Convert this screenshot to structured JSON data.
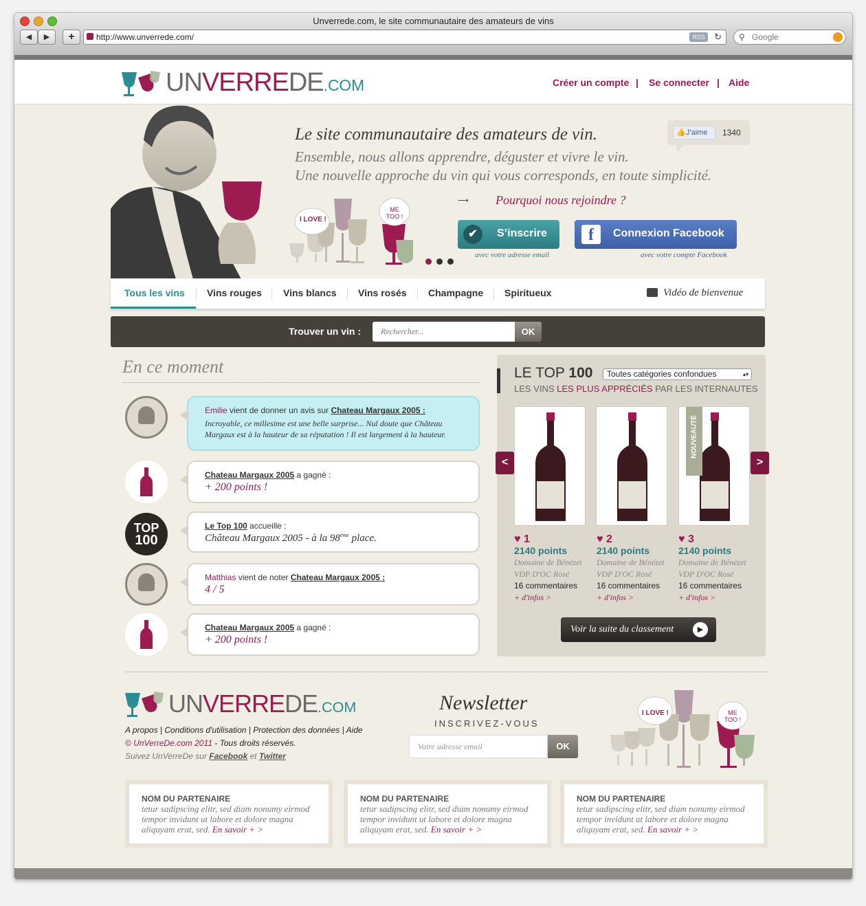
{
  "browser": {
    "window_title": "Unverrede.com, le site communautaire des amateurs de vins",
    "url": "http://www.unverrede.com/",
    "search_placeholder": "Google",
    "rss": "RSS"
  },
  "logo": {
    "part1": "UN",
    "part2": "VERRE",
    "part3": "DE",
    "part4": ".COM"
  },
  "header": {
    "links": [
      "Créer un compte",
      "Se connecter",
      "Aide"
    ],
    "separator": "|"
  },
  "hero": {
    "title": "Le site communautaire des amateurs de vin.",
    "line2": "Ensemble, nous allons apprendre, déguster et vivre le vin.",
    "line3": "Une nouvelle approche du vin qui vous corresponds, en toute simplicité.",
    "why_join": "Pourquoi nous rejoindre ?",
    "bubble_love": "I LOVE !",
    "bubble_metoo": "ME TOO !",
    "like_label": "J'aime",
    "like_count": "1340",
    "signup_label": "S’inscrire",
    "signup_sub": "avec votre adresse email",
    "facebook_label": "Connexion Facebook",
    "facebook_sub": "avec votre compte Facebook",
    "facebook_f": "f"
  },
  "menu": {
    "items": [
      "Tous les vins",
      "Vins rouges",
      "Vins blancs",
      "Vins rosés",
      "Champagne",
      "Spiritueux"
    ],
    "video": "Vidéo de bienvenue"
  },
  "find": {
    "label": "Trouver un vin :",
    "placeholder": "Rechercher...",
    "ok": "OK"
  },
  "feed": {
    "title": "En ce moment",
    "items": [
      {
        "user": "Emilie",
        "text": " vient de donner un avis sur ",
        "wine": "Chateau Margaux 2005 :",
        "quote": "Incroyable, ce millesime est une belle surprise... Nul doute que Château Margaux est à la hauteur de sa réputation ! Il est largement à la hauteur."
      },
      {
        "wine": "Chateau Margaux 2005",
        "text": " a gagné :",
        "points": "+ 200 points !"
      },
      {
        "wine": "Le Top 100",
        "text": " accueille :",
        "detail": "Château Margaux 2005 - à la 98",
        "sup": "ème",
        "detail_end": " place."
      },
      {
        "user": "Matthias",
        "text": " vient de noter ",
        "wine": "Chateau Margaux 2005 :",
        "rating": "4 / 5"
      },
      {
        "wine": "Chateau Margaux 2005",
        "text": " a gagné :",
        "points": "+ 200 points !"
      }
    ],
    "top100_badge": [
      "TOP",
      "100"
    ]
  },
  "top100": {
    "title_a": "LE TOP ",
    "title_b": "100",
    "select_value": "Toutes catégories confondues",
    "subtitle_a": "LES VINS ",
    "subtitle_b": "LES PLUS APPRÉCIÉS",
    "subtitle_c": " PAR LES INTERNAUTES",
    "new_ribbon": "NOUVEAUTÉ",
    "prev": "<",
    "next": ">",
    "wines": [
      {
        "rank": "1",
        "points": "2140 points",
        "domain": "Domaine de Bénézet",
        "appellation": "VDP D'OC Rosé",
        "comments": "16 commentaires",
        "more": "+ d'infos >"
      },
      {
        "rank": "2",
        "points": "2140 points",
        "domain": "Domaine de Bénézet",
        "appellation": "VDP D'OC Rosé",
        "comments": "16 commentaires",
        "more": "+ d'infos >"
      },
      {
        "rank": "3",
        "points": "2140 points",
        "domain": "Domaine de Bénézet",
        "appellation": "VDP D'OC Rosé",
        "comments": "16 commentaires",
        "more": "+ d'infos >"
      }
    ],
    "more_button": "Voir la suite du classement"
  },
  "footer": {
    "links": [
      "A propos",
      "Conditions d'utilisation",
      "Protection des données",
      "Aide"
    ],
    "copyright_a": "© UnVerreDe.com 2011",
    "copyright_b": " - Tous droits réservés.",
    "follow": "Suivez UnVerreDe sur ",
    "facebook": "Facebook",
    "and": " et ",
    "twitter": "Twitter",
    "newsletter_title": "Newsletter",
    "newsletter_sub": "INSCRIVEZ-VOUS",
    "email_placeholder": "Votre adresse email",
    "ok": "OK"
  },
  "partners": [
    {
      "name": "NOM DU PARTENAIRE",
      "text": "tetur sadipscing elitr, sed diam nonumy eirmod tempor invidunt ut labore et dolore magna aliquyam erat, sed. ",
      "more": "En savoir + >"
    },
    {
      "name": "NOM DU PARTENAIRE",
      "text": "tetur sadipscing elitr, sed diam nonumy eirmod tempor invidunt ut labore et dolore magna aliquyam erat, sed. ",
      "more": "En savoir + >"
    },
    {
      "name": "NOM DU PARTENAIRE",
      "text": "tetur sadipscing elitr, sed diam nonumy eirmod tempor invidunt ut labore et dolore magna aliquyam erat, sed. ",
      "more": "En savoir + >"
    }
  ],
  "colors": {
    "accent": "#9c1b50",
    "teal": "#2a8d94",
    "dark": "#46403b",
    "facebook": "#3c5fa8"
  }
}
